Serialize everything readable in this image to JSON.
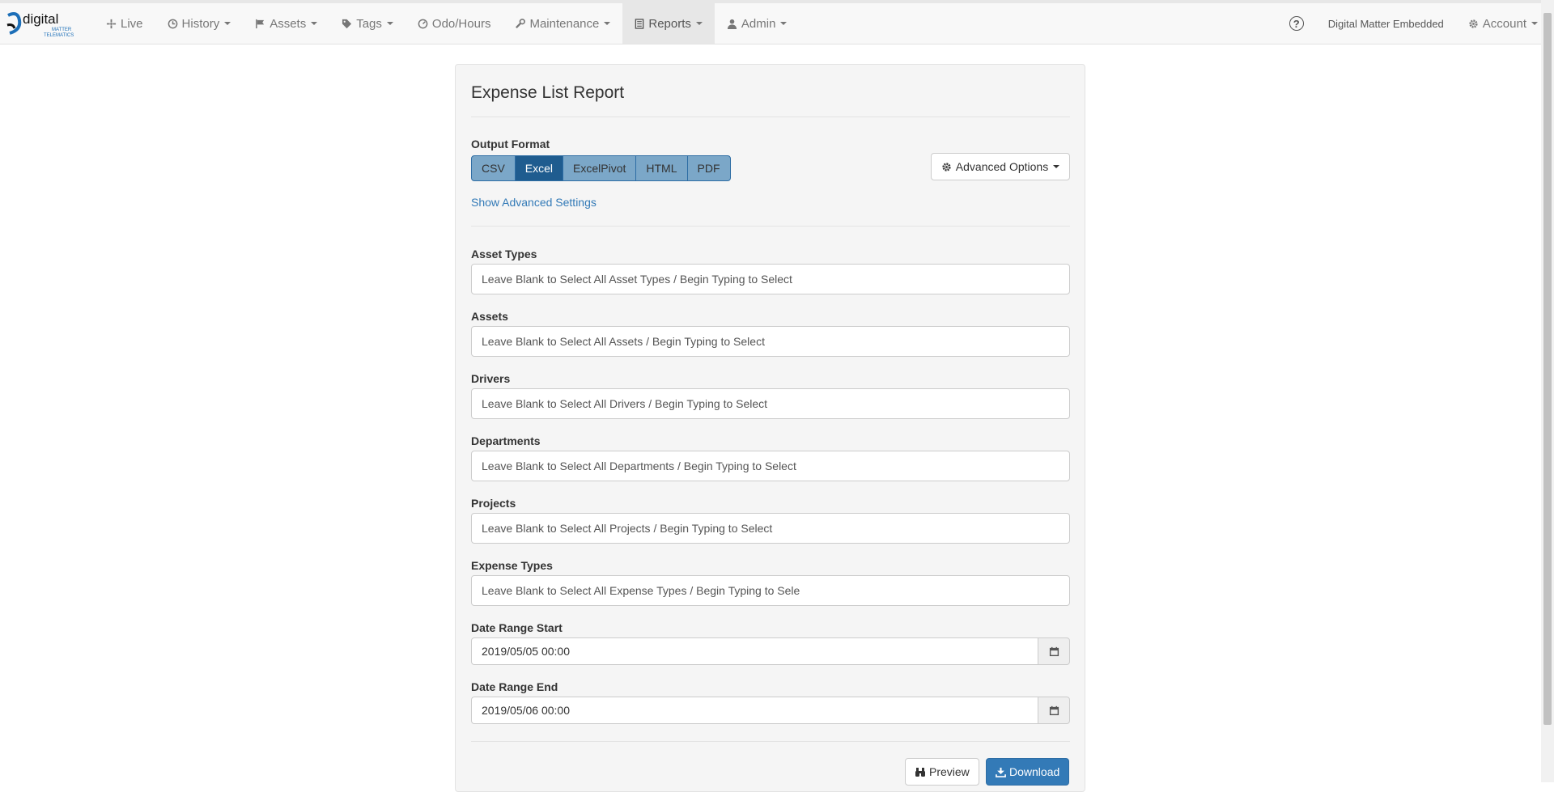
{
  "brand": {
    "word": "digital",
    "sub1": "MATTER",
    "sub2": "TELEMATICS"
  },
  "nav": {
    "items": [
      {
        "label": "Live",
        "icon": "crosshair-icon"
      },
      {
        "label": "History",
        "icon": "clock-icon"
      },
      {
        "label": "Assets",
        "icon": "flag-icon"
      },
      {
        "label": "Tags",
        "icon": "tag-icon"
      },
      {
        "label": "Odo/Hours",
        "icon": "gauge-icon"
      },
      {
        "label": "Maintenance",
        "icon": "wrench-icon"
      },
      {
        "label": "Reports",
        "icon": "report-icon"
      },
      {
        "label": "Admin",
        "icon": "user-icon"
      }
    ],
    "help": "?",
    "org_name": "Digital Matter Embedded",
    "account": "Account"
  },
  "report": {
    "title": "Expense List Report",
    "output_format_label": "Output Format",
    "formats": [
      "CSV",
      "Excel",
      "ExcelPivot",
      "HTML",
      "PDF"
    ],
    "selected_format": "Excel",
    "advanced_options": "Advanced Options",
    "show_advanced": "Show Advanced Settings",
    "filters": [
      {
        "label": "Asset Types",
        "placeholder": "Leave Blank to Select All Asset Types / Begin Typing to Select"
      },
      {
        "label": "Assets",
        "placeholder": "Leave Blank to Select All Assets / Begin Typing to Select"
      },
      {
        "label": "Drivers",
        "placeholder": "Leave Blank to Select All Drivers / Begin Typing to Select"
      },
      {
        "label": "Departments",
        "placeholder": "Leave Blank to Select All Departments / Begin Typing to Select"
      },
      {
        "label": "Projects",
        "placeholder": "Leave Blank to Select All Projects / Begin Typing to Select"
      },
      {
        "label": "Expense Types",
        "placeholder": "Leave Blank to Select All Expense Types / Begin Typing to Sele"
      }
    ],
    "date_start_label": "Date Range Start",
    "date_start_value": "2019/05/05 00:00",
    "date_end_label": "Date Range End",
    "date_end_value": "2019/05/06 00:00",
    "preview": "Preview",
    "download": "Download"
  },
  "colors": {
    "primary": "#337ab7",
    "format_active": "#1f5c8f",
    "format_inactive": "#7ba7c8"
  }
}
